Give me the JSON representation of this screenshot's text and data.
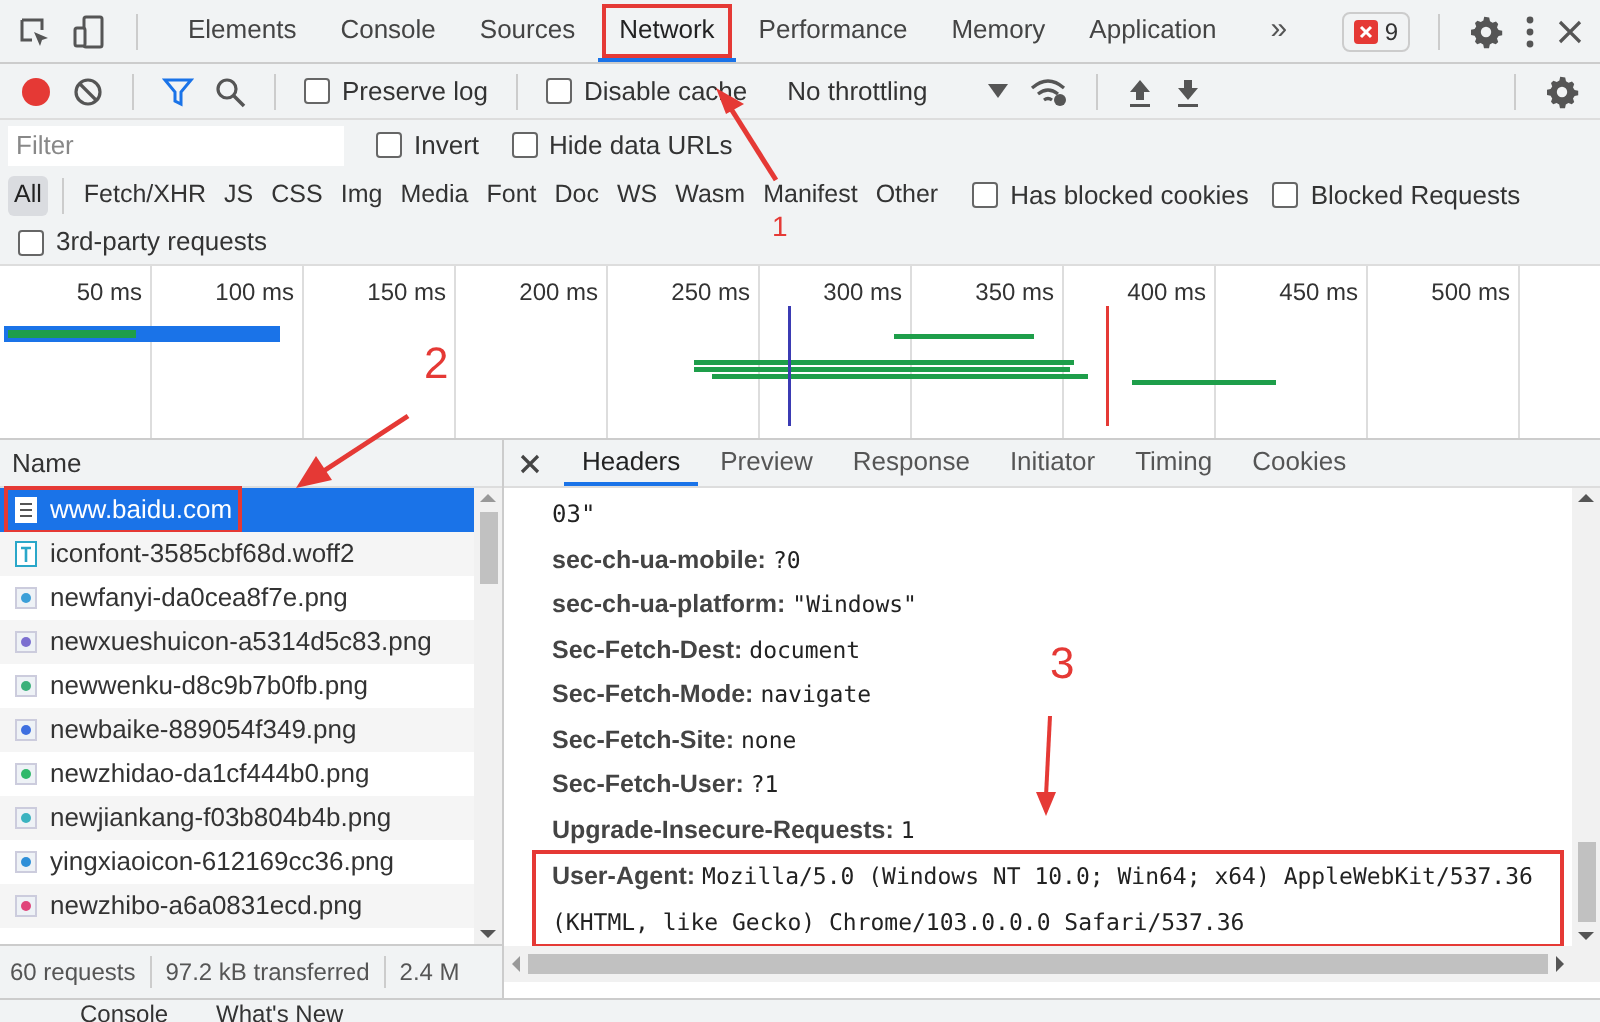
{
  "devtools_tabs": [
    {
      "label": "Elements",
      "selected": false,
      "highlighted": false
    },
    {
      "label": "Console",
      "selected": false,
      "highlighted": false
    },
    {
      "label": "Sources",
      "selected": false,
      "highlighted": false
    },
    {
      "label": "Network",
      "selected": true,
      "highlighted": true
    },
    {
      "label": "Performance",
      "selected": false,
      "highlighted": false
    },
    {
      "label": "Memory",
      "selected": false,
      "highlighted": false
    },
    {
      "label": "Application",
      "selected": false,
      "highlighted": false
    }
  ],
  "more_tabs": "»",
  "error_count": "9",
  "toolbar": {
    "recording": true,
    "filter_active": true,
    "options": [
      {
        "label": "Preserve log",
        "checked": false
      },
      {
        "label": "Disable cache",
        "checked": false
      }
    ],
    "throttling": "No throttling"
  },
  "filter": {
    "placeholder": "Filter",
    "options": [
      {
        "label": "Invert",
        "checked": false
      },
      {
        "label": "Hide data URLs",
        "checked": false
      }
    ]
  },
  "type_filters": [
    {
      "label": "All",
      "selected": true
    },
    {
      "label": "Fetch/XHR",
      "selected": false
    },
    {
      "label": "JS",
      "selected": false
    },
    {
      "label": "CSS",
      "selected": false
    },
    {
      "label": "Img",
      "selected": false
    },
    {
      "label": "Media",
      "selected": false
    },
    {
      "label": "Font",
      "selected": false
    },
    {
      "label": "Doc",
      "selected": false
    },
    {
      "label": "WS",
      "selected": false
    },
    {
      "label": "Wasm",
      "selected": false
    },
    {
      "label": "Manifest",
      "selected": false
    },
    {
      "label": "Other",
      "selected": false
    }
  ],
  "blocking_options": [
    {
      "label": "Has blocked cookies",
      "checked": false
    },
    {
      "label": "Blocked Requests",
      "checked": false
    }
  ],
  "third_party": {
    "label": "3rd-party requests",
    "checked": false
  },
  "timeline": {
    "ticks": [
      "50 ms",
      "100 ms",
      "150 ms",
      "200 ms",
      "250 ms",
      "300 ms",
      "350 ms",
      "400 ms",
      "450 ms",
      "500 ms"
    ]
  },
  "requests": {
    "column": "Name",
    "rows": [
      {
        "name": "www.baidu.com",
        "kind": "document",
        "selected": true,
        "highlighted": true
      },
      {
        "name": "iconfont-3585cbf68d.woff2",
        "kind": "font",
        "selected": false,
        "highlighted": false
      },
      {
        "name": "newfanyi-da0cea8f7e.png",
        "kind": "image",
        "color": "#3b9fd8",
        "selected": false,
        "highlighted": false
      },
      {
        "name": "newxueshuicon-a5314d5c83.png",
        "kind": "image",
        "color": "#7b6fd0",
        "selected": false,
        "highlighted": false
      },
      {
        "name": "newwenku-d8c9b7b0fb.png",
        "kind": "image",
        "color": "#3bb07a",
        "selected": false,
        "highlighted": false
      },
      {
        "name": "newbaike-889054f349.png",
        "kind": "image",
        "color": "#3d6fe0",
        "selected": false,
        "highlighted": false
      },
      {
        "name": "newzhidao-da1cf444b0.png",
        "kind": "image",
        "color": "#2fb86a",
        "selected": false,
        "highlighted": false
      },
      {
        "name": "newjiankang-f03b804b4b.png",
        "kind": "image",
        "color": "#3ab3c0",
        "selected": false,
        "highlighted": false
      },
      {
        "name": "yingxiaoicon-612169cc36.png",
        "kind": "image",
        "color": "#2e8fd8",
        "selected": false,
        "highlighted": false
      },
      {
        "name": "newzhibo-a6a0831ecd.png",
        "kind": "image",
        "color": "#e0457a",
        "selected": false,
        "highlighted": false
      }
    ]
  },
  "status_bar": [
    "60 requests",
    "97.2 kB transferred",
    "2.4 M"
  ],
  "detail_tabs": [
    {
      "label": "Headers",
      "selected": true
    },
    {
      "label": "Preview",
      "selected": false
    },
    {
      "label": "Response",
      "selected": false
    },
    {
      "label": "Initiator",
      "selected": false
    },
    {
      "label": "Timing",
      "selected": false
    },
    {
      "label": "Cookies",
      "selected": false
    }
  ],
  "headers": [
    {
      "kind": "continuation",
      "value": "03\""
    },
    {
      "kind": "header",
      "name": "sec-ch-ua-mobile:",
      "value": "?0",
      "highlighted": false
    },
    {
      "kind": "header",
      "name": "sec-ch-ua-platform:",
      "value": "\"Windows\"",
      "highlighted": false
    },
    {
      "kind": "header",
      "name": "Sec-Fetch-Dest:",
      "value": "document",
      "highlighted": false
    },
    {
      "kind": "header",
      "name": "Sec-Fetch-Mode:",
      "value": "navigate",
      "highlighted": false
    },
    {
      "kind": "header",
      "name": "Sec-Fetch-Site:",
      "value": "none",
      "highlighted": false
    },
    {
      "kind": "header",
      "name": "Sec-Fetch-User:",
      "value": "?1",
      "highlighted": false
    },
    {
      "kind": "header",
      "name": "Upgrade-Insecure-Requests:",
      "value": "1",
      "highlighted": false
    },
    {
      "kind": "header",
      "name": "User-Agent:",
      "value": "Mozilla/5.0 (Windows NT 10.0; Win64; x64) AppleWebKit/537.36 (KHTML, like Gecko) Chrome/103.0.0.0 Safari/537.36",
      "highlighted": true
    }
  ],
  "drawer_tabs": [
    "Console",
    "What's New"
  ],
  "annotations": [
    "1",
    "2",
    "3"
  ]
}
